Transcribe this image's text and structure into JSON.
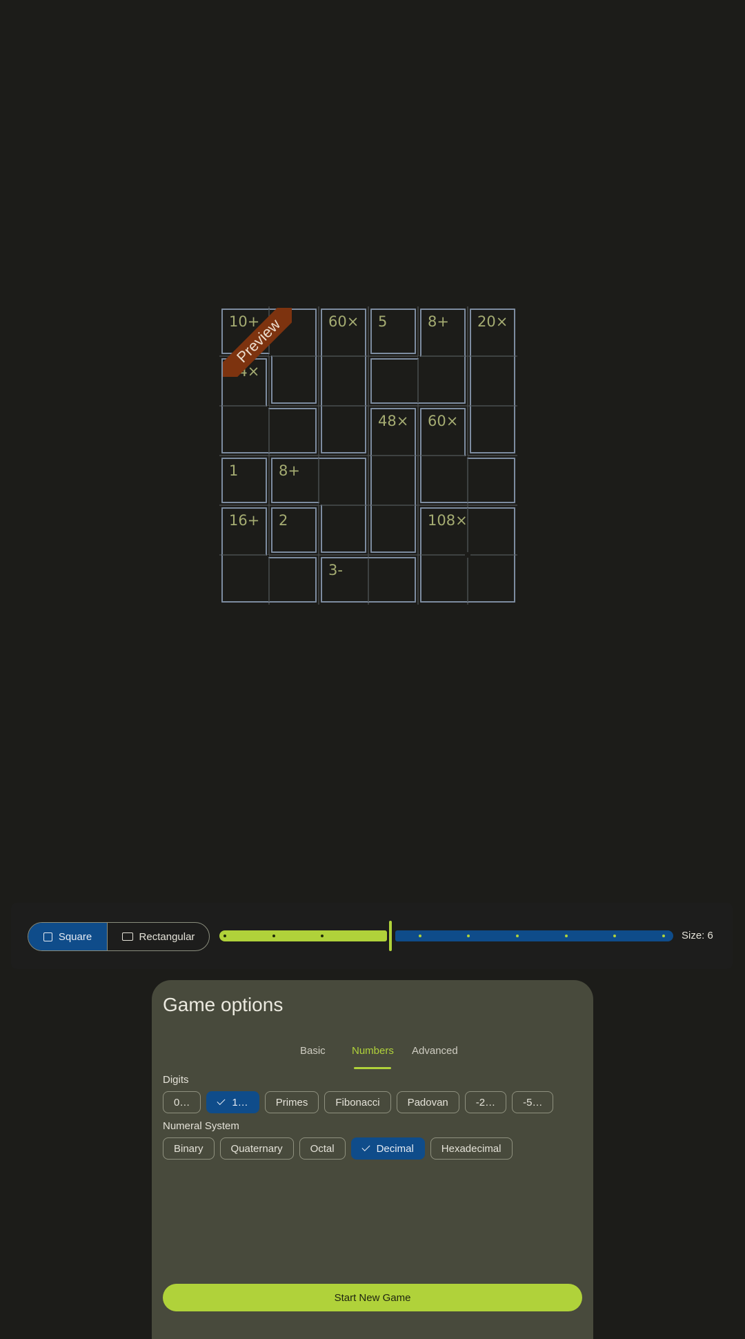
{
  "board": {
    "preview_label": "Preview",
    "clues": [
      "10+",
      "60×",
      "5",
      "8+",
      "20×",
      "24×",
      "48×",
      "60×",
      "1",
      "8+",
      "16+",
      "2",
      "108×",
      "3-"
    ]
  },
  "size_selector": {
    "square_label": "Square",
    "rectangular_label": "Rectangular",
    "slider_value": 6,
    "slider_min": 3,
    "slider_max": 12,
    "size_label": "Size: 6"
  },
  "options": {
    "title": "Game options",
    "tabs": [
      {
        "label": "Basic"
      },
      {
        "label": "Numbers"
      },
      {
        "label": "Advanced"
      }
    ],
    "digits_label": "Digits",
    "digits": [
      "0…",
      "1…",
      "Primes",
      "Fibonacci",
      "Padovan",
      "-2…",
      "-5…"
    ],
    "numeral_label": "Numeral System",
    "numerals": [
      "Binary",
      "Quaternary",
      "Octal",
      "Decimal",
      "Hexadecimal"
    ],
    "start_label": "Start New Game"
  },
  "colors": {
    "accent": "#b0d23a",
    "selected": "#0f4c8a",
    "panel": "#484a3c",
    "background": "#1c1c19"
  }
}
